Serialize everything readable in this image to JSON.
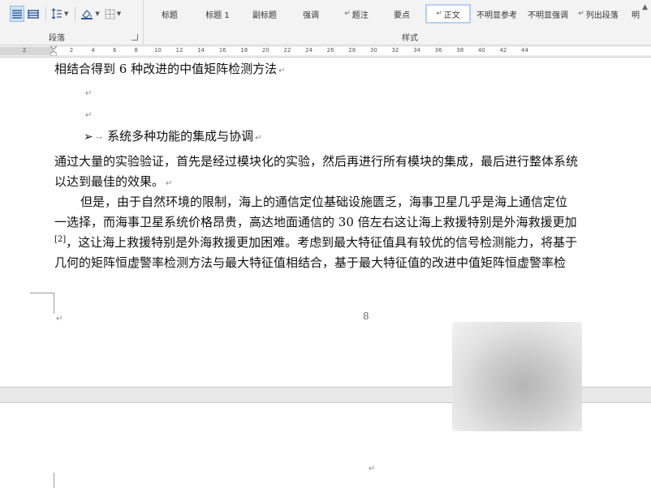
{
  "ribbon": {
    "paragraph_group_label": "段落",
    "styles_group_label": "样式",
    "styles": [
      {
        "label": "标题",
        "marker": ""
      },
      {
        "label": "标题 1",
        "marker": ""
      },
      {
        "label": "副标题",
        "marker": ""
      },
      {
        "label": "强调",
        "marker": ""
      },
      {
        "label": "题注",
        "marker": "↵"
      },
      {
        "label": "要点",
        "marker": ""
      },
      {
        "label": "正文",
        "marker": "↵",
        "selected": true
      },
      {
        "label": "不明显参考",
        "marker": ""
      },
      {
        "label": "不明显强调",
        "marker": ""
      },
      {
        "label": "列出段落",
        "marker": "↵"
      },
      {
        "label": "明",
        "marker": ""
      }
    ],
    "tools": [
      "align-left-icon",
      "align-justify-icon",
      "line-spacing-icon",
      "shading-icon",
      "borders-icon"
    ]
  },
  "ruler": {
    "numbers": [
      "2",
      "2",
      "4",
      "6",
      "8",
      "10",
      "12",
      "14",
      "16",
      "18",
      "20",
      "22",
      "24",
      "26",
      "28",
      "30",
      "32",
      "34",
      "36",
      "38",
      "40",
      "42",
      "44"
    ]
  },
  "document": {
    "line1": "相结合得到 6 种改进的中值矩阵检测方法",
    "bullet_symbol": "➢",
    "heading": "系统多种功能的集成与协调",
    "para1_line1": "通过大量的实验验证，首先是经过模块化的实验，然后再进行所有模块的集成，最后进行整体系统",
    "para1_line2": "以达到最佳的效果。",
    "para2_line1": "但是，由于自然环境的限制，海上的通信定位基础设施匮乏，海事卫星几乎是海上通信定位",
    "para2_line2": "一选择，而海事卫星系统价格昂贵，高达地面通信的 30 倍左右这让海上救援特别是外海救援更加",
    "para2_line3_ref": "[2]",
    "para2_line3": "，这让海上救援特别是外海救援更加困难。考虑到最大特征值具有较优的信号检测能力，将基于",
    "para2_line4": "几何的矩阵恒虚警率检测方法与最大特征值相结合，基于最大特征值的改进中值矩阵恒虚警率检",
    "paragraph_mark": "↵",
    "page_number": "8"
  }
}
